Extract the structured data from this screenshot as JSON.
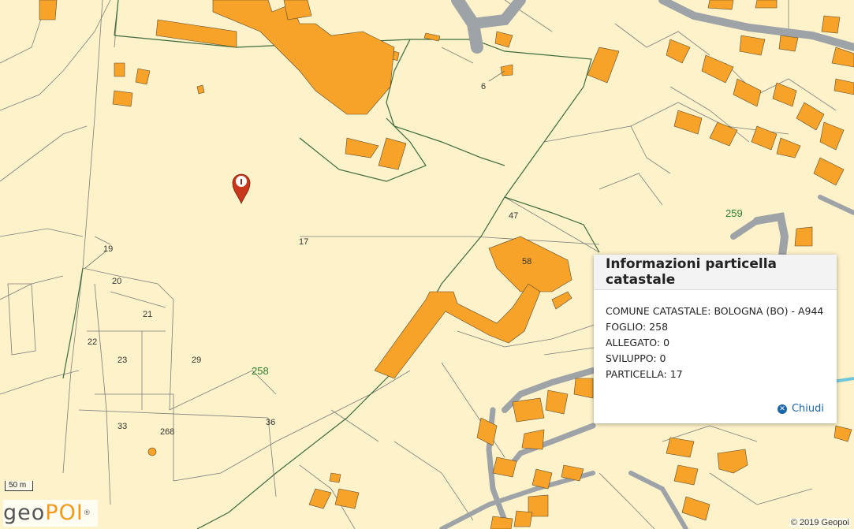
{
  "map": {
    "parcel_labels": [
      {
        "id": "6",
        "text": "6"
      },
      {
        "id": "17",
        "text": "17"
      },
      {
        "id": "19",
        "text": "19"
      },
      {
        "id": "20",
        "text": "20"
      },
      {
        "id": "21",
        "text": "21"
      },
      {
        "id": "22",
        "text": "22"
      },
      {
        "id": "23",
        "text": "23"
      },
      {
        "id": "29",
        "text": "29"
      },
      {
        "id": "33",
        "text": "33"
      },
      {
        "id": "36",
        "text": "36"
      },
      {
        "id": "47",
        "text": "47"
      },
      {
        "id": "58",
        "text": "58"
      },
      {
        "id": "268",
        "text": "268"
      }
    ],
    "sheet_labels": [
      {
        "id": "258",
        "text": "258"
      },
      {
        "id": "259",
        "text": "259"
      }
    ],
    "colors": {
      "background": "#fdf2c9",
      "building": "#f7a32a",
      "road": "#9ea3a8",
      "sheet_boundary": "#3d6b3d",
      "marker": "#c8381d",
      "accent": "#1b65a8"
    }
  },
  "marker": {
    "icon": "info-marker-icon",
    "glyph": "I"
  },
  "popup": {
    "title": "Informazioni particella catastale",
    "lines": [
      "COMUNE CATASTALE: BOLOGNA (BO) - A944",
      "FOGLIO: 258",
      "ALLEGATO: 0",
      "SVILUPPO: 0",
      "PARTICELLA: 17"
    ],
    "close_label": "Chiudi",
    "close_icon": "close-circle-icon"
  },
  "scale": {
    "label": "50 m"
  },
  "logo": {
    "geo": "geo",
    "poi": "POI",
    "registered": "®"
  },
  "copyright": "© 2019 Geopoi"
}
